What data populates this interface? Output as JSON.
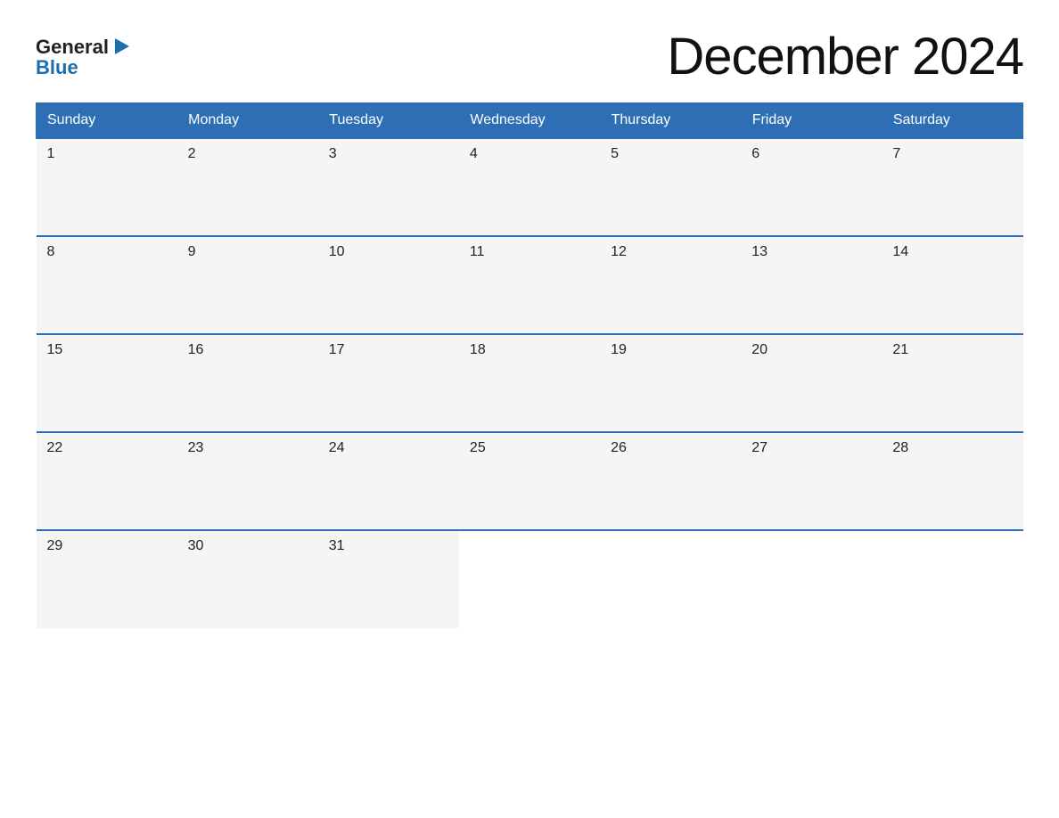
{
  "logo": {
    "general": "General",
    "blue": "Blue",
    "arrow": "▶"
  },
  "title": "December 2024",
  "days_of_week": [
    "Sunday",
    "Monday",
    "Tuesday",
    "Wednesday",
    "Thursday",
    "Friday",
    "Saturday"
  ],
  "weeks": [
    [
      {
        "day": "1",
        "empty": false
      },
      {
        "day": "2",
        "empty": false
      },
      {
        "day": "3",
        "empty": false
      },
      {
        "day": "4",
        "empty": false
      },
      {
        "day": "5",
        "empty": false
      },
      {
        "day": "6",
        "empty": false
      },
      {
        "day": "7",
        "empty": false
      }
    ],
    [
      {
        "day": "8",
        "empty": false
      },
      {
        "day": "9",
        "empty": false
      },
      {
        "day": "10",
        "empty": false
      },
      {
        "day": "11",
        "empty": false
      },
      {
        "day": "12",
        "empty": false
      },
      {
        "day": "13",
        "empty": false
      },
      {
        "day": "14",
        "empty": false
      }
    ],
    [
      {
        "day": "15",
        "empty": false
      },
      {
        "day": "16",
        "empty": false
      },
      {
        "day": "17",
        "empty": false
      },
      {
        "day": "18",
        "empty": false
      },
      {
        "day": "19",
        "empty": false
      },
      {
        "day": "20",
        "empty": false
      },
      {
        "day": "21",
        "empty": false
      }
    ],
    [
      {
        "day": "22",
        "empty": false
      },
      {
        "day": "23",
        "empty": false
      },
      {
        "day": "24",
        "empty": false
      },
      {
        "day": "25",
        "empty": false
      },
      {
        "day": "26",
        "empty": false
      },
      {
        "day": "27",
        "empty": false
      },
      {
        "day": "28",
        "empty": false
      }
    ],
    [
      {
        "day": "29",
        "empty": false
      },
      {
        "day": "30",
        "empty": false
      },
      {
        "day": "31",
        "empty": false
      },
      {
        "day": "",
        "empty": true
      },
      {
        "day": "",
        "empty": true
      },
      {
        "day": "",
        "empty": true
      },
      {
        "day": "",
        "empty": true
      }
    ]
  ]
}
